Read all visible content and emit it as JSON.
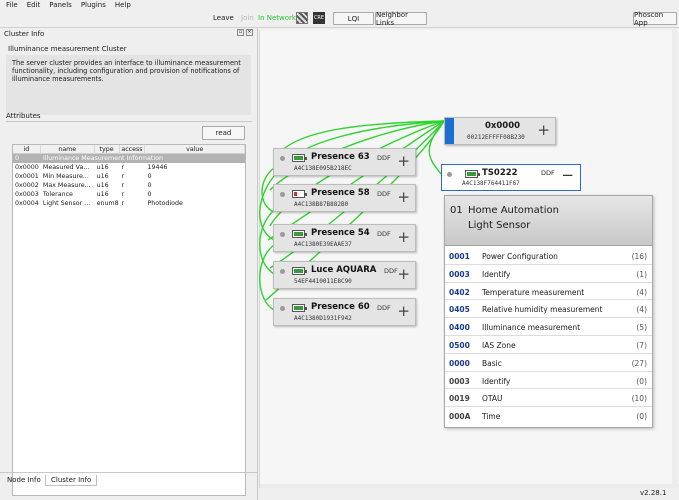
{
  "menu": [
    "File",
    "Edit",
    "Panels",
    "Plugins",
    "Help"
  ],
  "toolbar": {
    "leave": "Leave",
    "join": "Join",
    "network_status": "In Network",
    "cre_label": "CRE",
    "lqi": "LQI",
    "neighbor_links": "Neighbor Links",
    "phoscon_app": "Phoscon App",
    "status_color": "#2fbf2f"
  },
  "cluster_info": {
    "panel_title": "Cluster Info",
    "cluster_name": "Illuminance measurement Cluster",
    "description": "The server cluster provides an interface to illuminance measurement functionality, including configuration and provision of notifications of illuminance measurements.",
    "attributes_label": "Attributes",
    "read_button": "read",
    "columns": [
      "id",
      "name",
      "type",
      "access",
      "value"
    ],
    "rows": [
      {
        "id": "0",
        "name": "Illuminance Measurement Information",
        "type": "",
        "access": "",
        "value": "",
        "selected": true
      },
      {
        "id": "0x0000",
        "name": "Measured Va...",
        "type": "u16",
        "access": "r",
        "value": "19446"
      },
      {
        "id": "0x0001",
        "name": "Min Measure...",
        "type": "u16",
        "access": "r",
        "value": "0"
      },
      {
        "id": "0x0002",
        "name": "Max Measure...",
        "type": "u16",
        "access": "r",
        "value": "0"
      },
      {
        "id": "0x0003",
        "name": "Tolerance",
        "type": "u16",
        "access": "r",
        "value": "0"
      },
      {
        "id": "0x0004",
        "name": "Light Sensor ...",
        "type": "enum8",
        "access": "r",
        "value": "Photodiode"
      }
    ]
  },
  "bottom_tabs": [
    "Node Info",
    "Cluster Info"
  ],
  "coordinator": {
    "name": "0x0000",
    "mac": "00212EFFFF08B230"
  },
  "nodes": [
    {
      "name": "Presence 63",
      "ddf": "DDF",
      "mac": "A4C138E095B218EC",
      "battery": 0.85,
      "battery_color": "#3a9a3a"
    },
    {
      "name": "Presence 58",
      "ddf": "DDF",
      "mac": "A4C138B87B882B0",
      "battery": 0.2,
      "battery_color": "#d03030"
    },
    {
      "name": "Presence 54",
      "ddf": "DDF",
      "mac": "A4C1380E39EAAE37",
      "battery": 0.85,
      "battery_color": "#3a9a3a"
    },
    {
      "name": "Luce AQUARA",
      "ddf": "DDF",
      "mac": "54EF4410011E8C90",
      "battery": 0.85,
      "battery_color": "#3a9a3a"
    },
    {
      "name": "Presence 60",
      "ddf": "DDF",
      "mac": "A4C1380D1931F942",
      "battery": 0.85,
      "battery_color": "#3a9a3a"
    }
  ],
  "selected_node": {
    "name": "TS0222",
    "ddf": "DDF",
    "mac": "A4C138F764411F67",
    "battery": 0.85
  },
  "endpoint": {
    "number": "01",
    "profile": "Home Automation",
    "device": "Light Sensor",
    "clusters": [
      {
        "id": "0001",
        "name": "Power Configuration",
        "count": "(16)",
        "side": "server"
      },
      {
        "id": "0003",
        "name": "Identify",
        "count": "(1)",
        "side": "server"
      },
      {
        "id": "0402",
        "name": "Temperature measurement",
        "count": "(4)",
        "side": "server"
      },
      {
        "id": "0405",
        "name": "Relative humidity measurement",
        "count": "(4)",
        "side": "server"
      },
      {
        "id": "0400",
        "name": "Illuminance measurement",
        "count": "(5)",
        "side": "server"
      },
      {
        "id": "0500",
        "name": "IAS Zone",
        "count": "(7)",
        "side": "server"
      },
      {
        "id": "0000",
        "name": "Basic",
        "count": "(27)",
        "side": "server"
      },
      {
        "id": "0003",
        "name": "Identify",
        "count": "(0)",
        "side": "client"
      },
      {
        "id": "0019",
        "name": "OTAU",
        "count": "(10)",
        "side": "client"
      },
      {
        "id": "000A",
        "name": "Time",
        "count": "(0)",
        "side": "client"
      }
    ]
  },
  "version": "v2.28.1"
}
